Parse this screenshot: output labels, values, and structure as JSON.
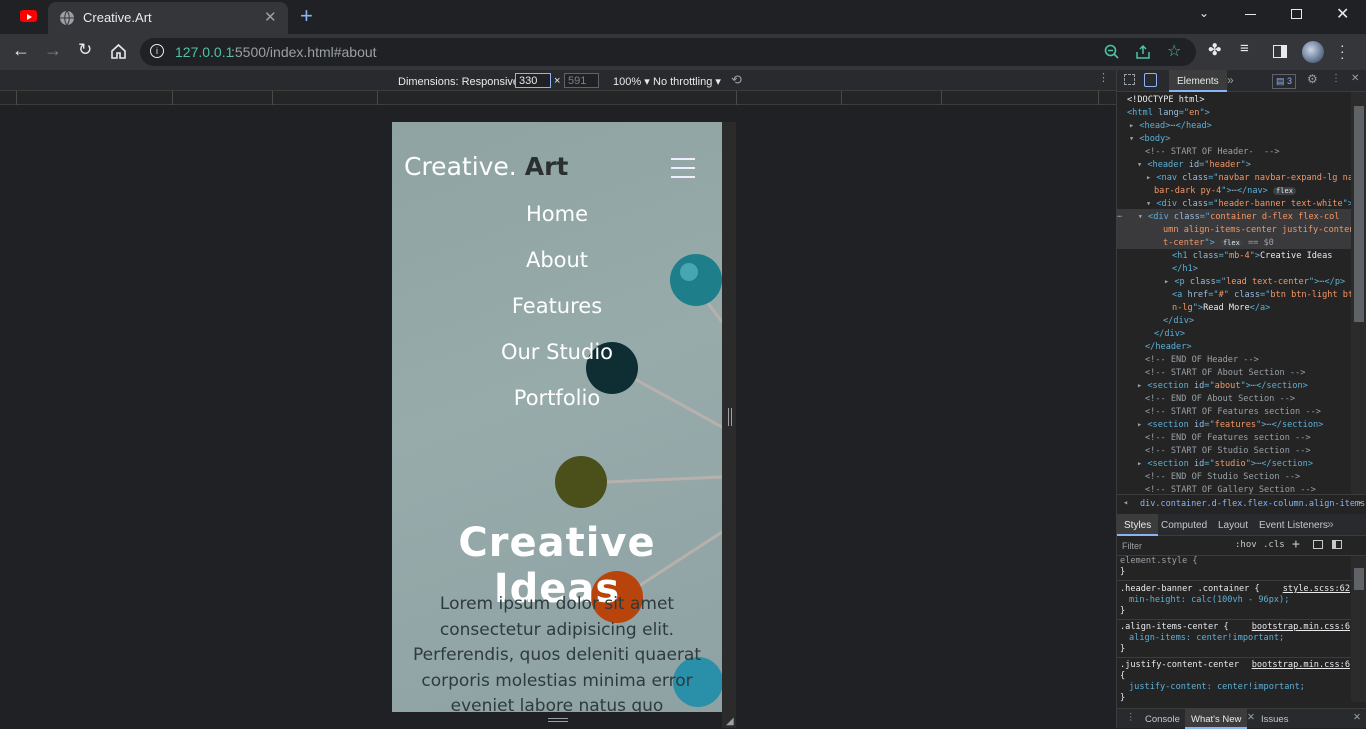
{
  "browser": {
    "tab_title": "Creative.Art",
    "url_host": "127.0.0.1",
    "url_rest": ":5500/index.html#about"
  },
  "device_toolbar": {
    "dimensions_label": "Dimensions: Responsive",
    "width": "330",
    "height": "591",
    "times": "×",
    "zoom": "100%",
    "throttle": "No throttling"
  },
  "site": {
    "brand_main": "Creative.",
    "brand_accent": "Art",
    "nav": [
      "Home",
      "About",
      "Features",
      "Our Studio",
      "Portfolio"
    ],
    "hero_title": "Creative Ideas",
    "hero_lead": "Lorem ipsum dolor sit amet consectetur adipisicing elit. Perferendis, quos deleniti quaerat corporis molestias minima error eveniet labore natus quo architecto"
  },
  "devtools": {
    "tab_elements": "Elements",
    "issue_count": "3",
    "breadcrumb": "div.container.d-flex.flex-column.align-items-center.ju",
    "styles_tabs": [
      "Styles",
      "Computed",
      "Layout",
      "Event Listeners"
    ],
    "filter_placeholder": "Filter",
    "hov": ":hov",
    "cls": ".cls",
    "drawer_tabs": [
      "Console",
      "What's New",
      "Issues"
    ],
    "rules": [
      {
        "selector": "element.style {",
        "prop": "",
        "source": "",
        "close": "}"
      },
      {
        "selector": ".header-banner .container {",
        "prop": "min-height: calc(100vh - 96px);",
        "source": "style.scss:62",
        "close": "}"
      },
      {
        "selector": ".align-items-center {",
        "prop": "align-items: center!important;",
        "source": "bootstrap.min.css:6",
        "close": "}"
      },
      {
        "selector": ".justify-content-center",
        "prop": "justify-content: center!important;",
        "source": "bootstrap.min.css:6",
        "close": "}"
      }
    ]
  },
  "colors": {
    "accent": "#8ab4f8",
    "tag": "#5db0d7",
    "attr_value": "#f29766",
    "selected_row": "#3a3a3d"
  }
}
